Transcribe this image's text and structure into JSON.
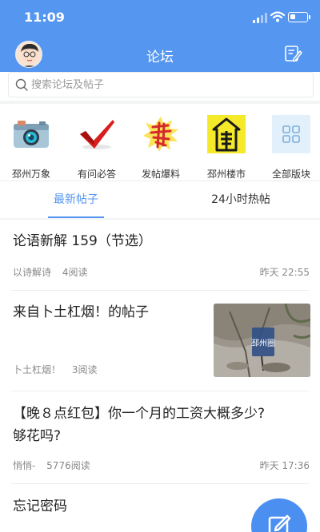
{
  "status": {
    "time": "11:09"
  },
  "nav": {
    "title": "论坛",
    "avatar_icon": "user-avatar",
    "edit_icon": "edit-post-icon"
  },
  "search": {
    "placeholder": "搜索论坛及帖子"
  },
  "categories": [
    {
      "label": "邳州万象",
      "icon": "camera-icon"
    },
    {
      "label": "有问必答",
      "icon": "checkmark-icon"
    },
    {
      "label": "发帖爆料",
      "icon": "burst-icon"
    },
    {
      "label": "邳州楼市",
      "icon": "building-icon"
    },
    {
      "label": "全部版块",
      "icon": "grid-icon"
    }
  ],
  "tabs": [
    {
      "label": "最新帖子",
      "active": true
    },
    {
      "label": "24小时热帖",
      "active": false
    }
  ],
  "posts": [
    {
      "title": "论语新解 159（节选）",
      "author": "以诗解诗",
      "reads": "4阅读",
      "time": "昨天 22:55"
    },
    {
      "title": "来自卜土杠烟！的帖子",
      "author": "卜土杠烟！",
      "reads": "3阅读",
      "time": "",
      "thumb_label": "邳州圈"
    },
    {
      "title_line1": "【晚８点红包】你一个月的工资大概多少?",
      "title_line2": "够花吗?",
      "author": "悄悄-",
      "reads": "5776阅读",
      "time": "昨天 17:36"
    },
    {
      "title": "忘记密码"
    }
  ],
  "colors": {
    "brand": "#5596f0",
    "meta_text": "#888888",
    "band": "#f3f4f6"
  }
}
